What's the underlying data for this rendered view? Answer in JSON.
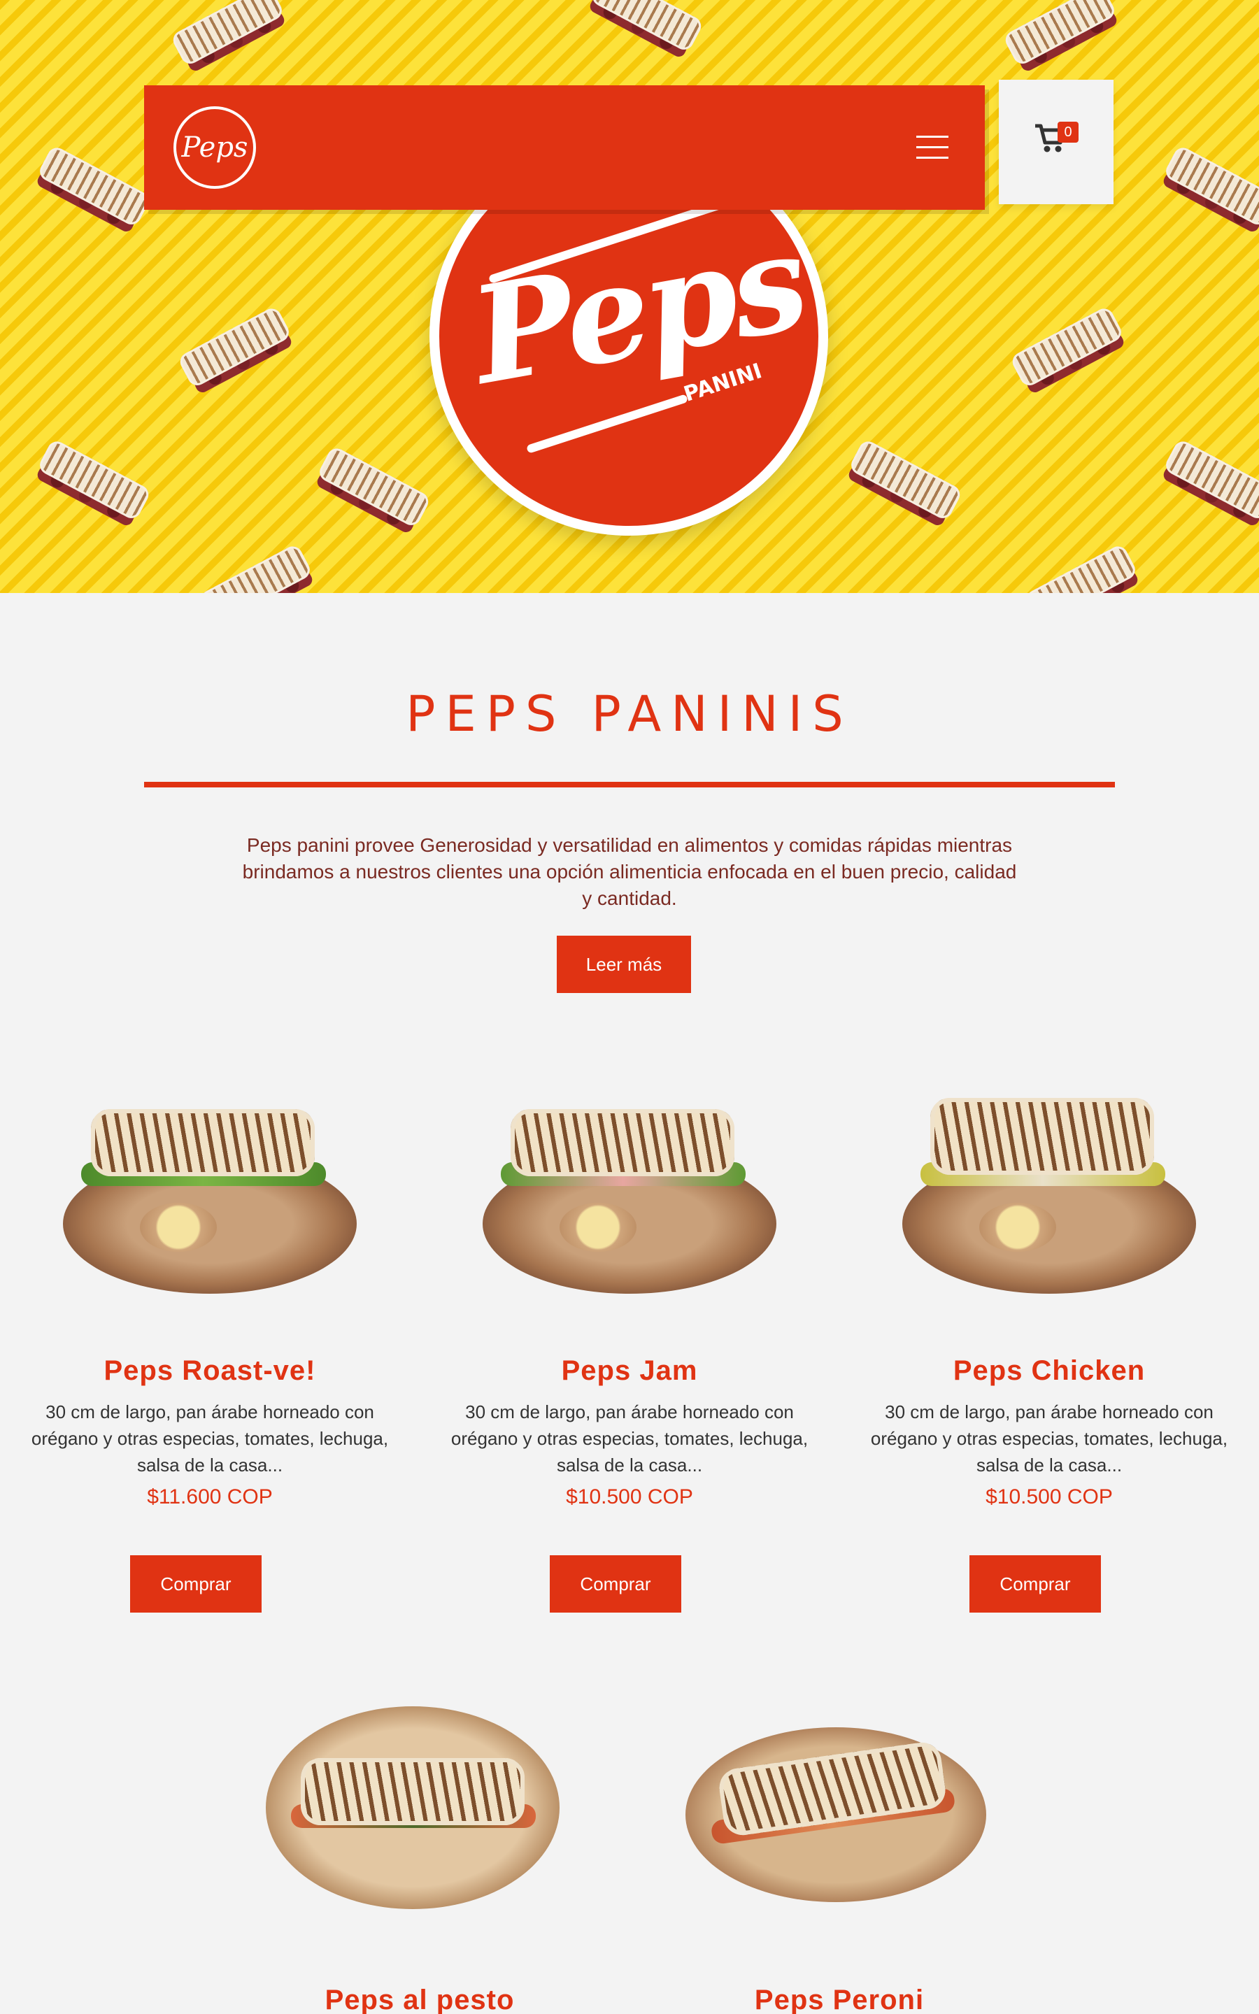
{
  "hero": {
    "logo_text": "Peps",
    "logo_subtext": "PANINI"
  },
  "nav": {
    "logo_text": "Peps",
    "cart_count": "0"
  },
  "intro": {
    "title": "PEPS PANINIS",
    "text": "Peps panini provee Generosidad y versatilidad en alimentos y comidas rápidas mientras brindamos a nuestros clientes una opción alimenticia enfocada en el buen precio, calidad y cantidad.",
    "button_label": "Leer más"
  },
  "products": [
    {
      "name": "Peps Roast-ve!",
      "description": "30 cm de largo, pan árabe horneado con orégano y otras especias, tomates, lechuga, salsa de la casa...",
      "price": "$11.600 COP",
      "button_label": "Comprar"
    },
    {
      "name": "Peps Jam",
      "description": "30 cm de largo, pan árabe horneado con orégano y otras especias, tomates, lechuga, salsa de la casa...",
      "price": "$10.500 COP",
      "button_label": "Comprar"
    },
    {
      "name": "Peps Chicken",
      "description": "30 cm de largo, pan árabe horneado con orégano y otras especias, tomates, lechuga, salsa de la casa...",
      "price": "$10.500 COP",
      "button_label": "Comprar"
    },
    {
      "name": "Peps al pesto"
    },
    {
      "name": "Peps Peroni"
    }
  ],
  "colors": {
    "brand_red": "#e03313",
    "hero_yellow": "#fbd80c",
    "background": "#f3f3f3"
  },
  "icons": {
    "menu": "hamburger-menu-icon",
    "cart": "shopping-cart-icon"
  }
}
